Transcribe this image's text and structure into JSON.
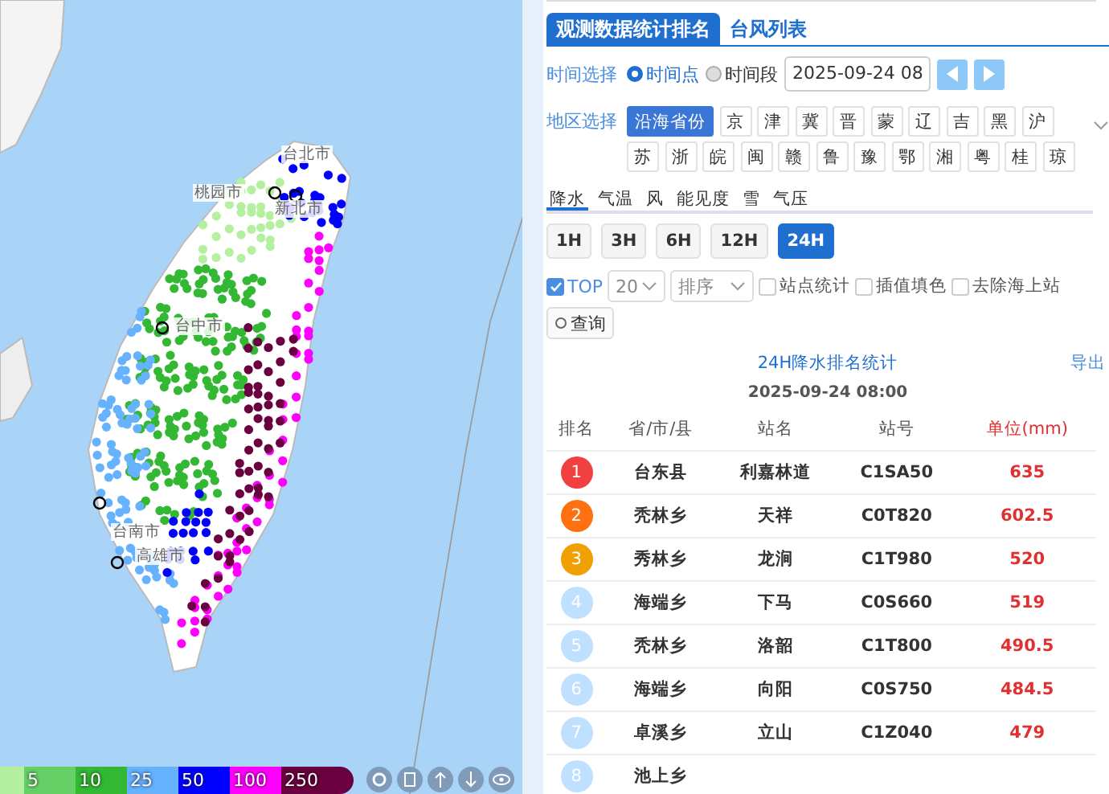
{
  "map": {
    "cities": [
      {
        "name": "台北市"
      },
      {
        "name": "桃园市"
      },
      {
        "name": "新北市"
      },
      {
        "name": "台中市"
      },
      {
        "name": "台南市"
      },
      {
        "name": "高雄市"
      }
    ],
    "legend": [
      {
        "color": "#b4f0a0"
      },
      {
        "label": "5",
        "color": "#66d066"
      },
      {
        "label": "10",
        "color": "#33b833"
      },
      {
        "label": "25",
        "color": "#66b2ff"
      },
      {
        "label": "50",
        "color": "#0000ff"
      },
      {
        "label": "100",
        "color": "#ff00ff"
      },
      {
        "label": "250",
        "color": "#6b0040"
      }
    ]
  },
  "tabs": [
    {
      "label": "观测数据统计排名",
      "selected": true
    },
    {
      "label": "台风列表",
      "selected": false
    }
  ],
  "time": {
    "label": "时间选择",
    "modes": [
      {
        "label": "时间点",
        "selected": true
      },
      {
        "label": "时间段",
        "selected": false
      }
    ],
    "value": "2025-09-24 08"
  },
  "region": {
    "label": "地区选择",
    "items": [
      {
        "label": "沿海省份",
        "selected": true
      },
      {
        "label": "京",
        "selected": false
      },
      {
        "label": "津",
        "selected": false
      },
      {
        "label": "冀",
        "selected": false
      },
      {
        "label": "晋",
        "selected": false
      },
      {
        "label": "蒙",
        "selected": false
      },
      {
        "label": "辽",
        "selected": false
      },
      {
        "label": "吉",
        "selected": false
      },
      {
        "label": "黑",
        "selected": false
      },
      {
        "label": "沪",
        "selected": false
      },
      {
        "label": "苏",
        "selected": false
      },
      {
        "label": "浙",
        "selected": false
      },
      {
        "label": "皖",
        "selected": false
      },
      {
        "label": "闽",
        "selected": false
      },
      {
        "label": "赣",
        "selected": false
      },
      {
        "label": "鲁",
        "selected": false
      },
      {
        "label": "豫",
        "selected": false
      },
      {
        "label": "鄂",
        "selected": false
      },
      {
        "label": "湘",
        "selected": false
      },
      {
        "label": "粤",
        "selected": false
      },
      {
        "label": "桂",
        "selected": false
      },
      {
        "label": "琼",
        "selected": false
      }
    ]
  },
  "elements": [
    {
      "label": "降水",
      "selected": true
    },
    {
      "label": "气温",
      "selected": false
    },
    {
      "label": "风",
      "selected": false
    },
    {
      "label": "能见度",
      "selected": false
    },
    {
      "label": "雪",
      "selected": false
    },
    {
      "label": "气压",
      "selected": false
    }
  ],
  "durations": [
    {
      "label": "1H",
      "selected": false
    },
    {
      "label": "3H",
      "selected": false
    },
    {
      "label": "6H",
      "selected": false
    },
    {
      "label": "12H",
      "selected": false
    },
    {
      "label": "24H",
      "selected": true
    }
  ],
  "options": {
    "top": {
      "label": "TOP",
      "checked": true
    },
    "count": "20",
    "sort_placeholder": "排序",
    "checks": [
      {
        "label": "站点统计",
        "checked": false
      },
      {
        "label": "插值填色",
        "checked": false
      },
      {
        "label": "去除海上站",
        "checked": false
      }
    ],
    "query": "查询"
  },
  "ranking": {
    "title": "24H降水排名统计",
    "export": "导出",
    "date": "2025-09-24 08:00",
    "columns": [
      "排名",
      "省/市/县",
      "站名",
      "站号",
      "单位(mm)"
    ],
    "rows": [
      {
        "rank": "1",
        "color": "#f04040",
        "county": "台东县",
        "station": "利嘉林道",
        "id": "C1SA50",
        "value": "635"
      },
      {
        "rank": "2",
        "color": "#ff7010",
        "county": "秃林乡",
        "station": "天祥",
        "id": "C0T820",
        "value": "602.5"
      },
      {
        "rank": "3",
        "color": "#f0a000",
        "county": "秀林乡",
        "station": "龙涧",
        "id": "C1T980",
        "value": "520"
      },
      {
        "rank": "4",
        "color": "#bfe0ff",
        "county": "海端乡",
        "station": "下马",
        "id": "C0S660",
        "value": "519"
      },
      {
        "rank": "5",
        "color": "#bfe0ff",
        "county": "秃林乡",
        "station": "洛韶",
        "id": "C1T800",
        "value": "490.5"
      },
      {
        "rank": "6",
        "color": "#bfe0ff",
        "county": "海端乡",
        "station": "向阳",
        "id": "C0S750",
        "value": "484.5"
      },
      {
        "rank": "7",
        "color": "#bfe0ff",
        "county": "卓溪乡",
        "station": "立山",
        "id": "C1Z040",
        "value": "479"
      },
      {
        "rank": "8",
        "color": "#bfe0ff",
        "county": "池上乡"
      }
    ]
  }
}
